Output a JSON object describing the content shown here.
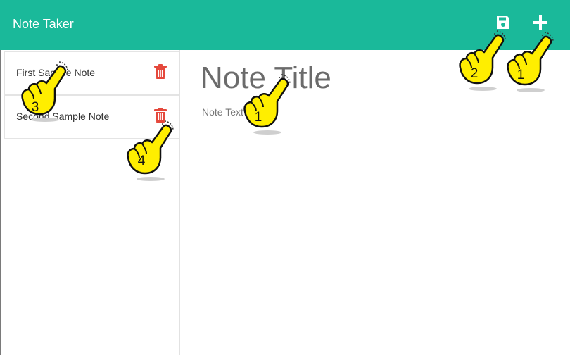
{
  "navbar": {
    "brand": "Note Taker",
    "save_icon": "save-icon",
    "add_icon": "plus-icon",
    "background": "#1ab99a"
  },
  "notes": [
    {
      "title": "First Sample Note",
      "delete_icon": "trash-icon"
    },
    {
      "title": "Second Sample Note",
      "delete_icon": "trash-icon"
    }
  ],
  "editor": {
    "title_placeholder": "Note Title",
    "text_placeholder": "Note Text"
  },
  "annotations": {
    "hand_icon": "pointing-hand-icon",
    "steps": [
      "1",
      "2",
      "1",
      "3",
      "4"
    ],
    "hand_color": "#ffee00",
    "delete_color": "#e5483c"
  }
}
